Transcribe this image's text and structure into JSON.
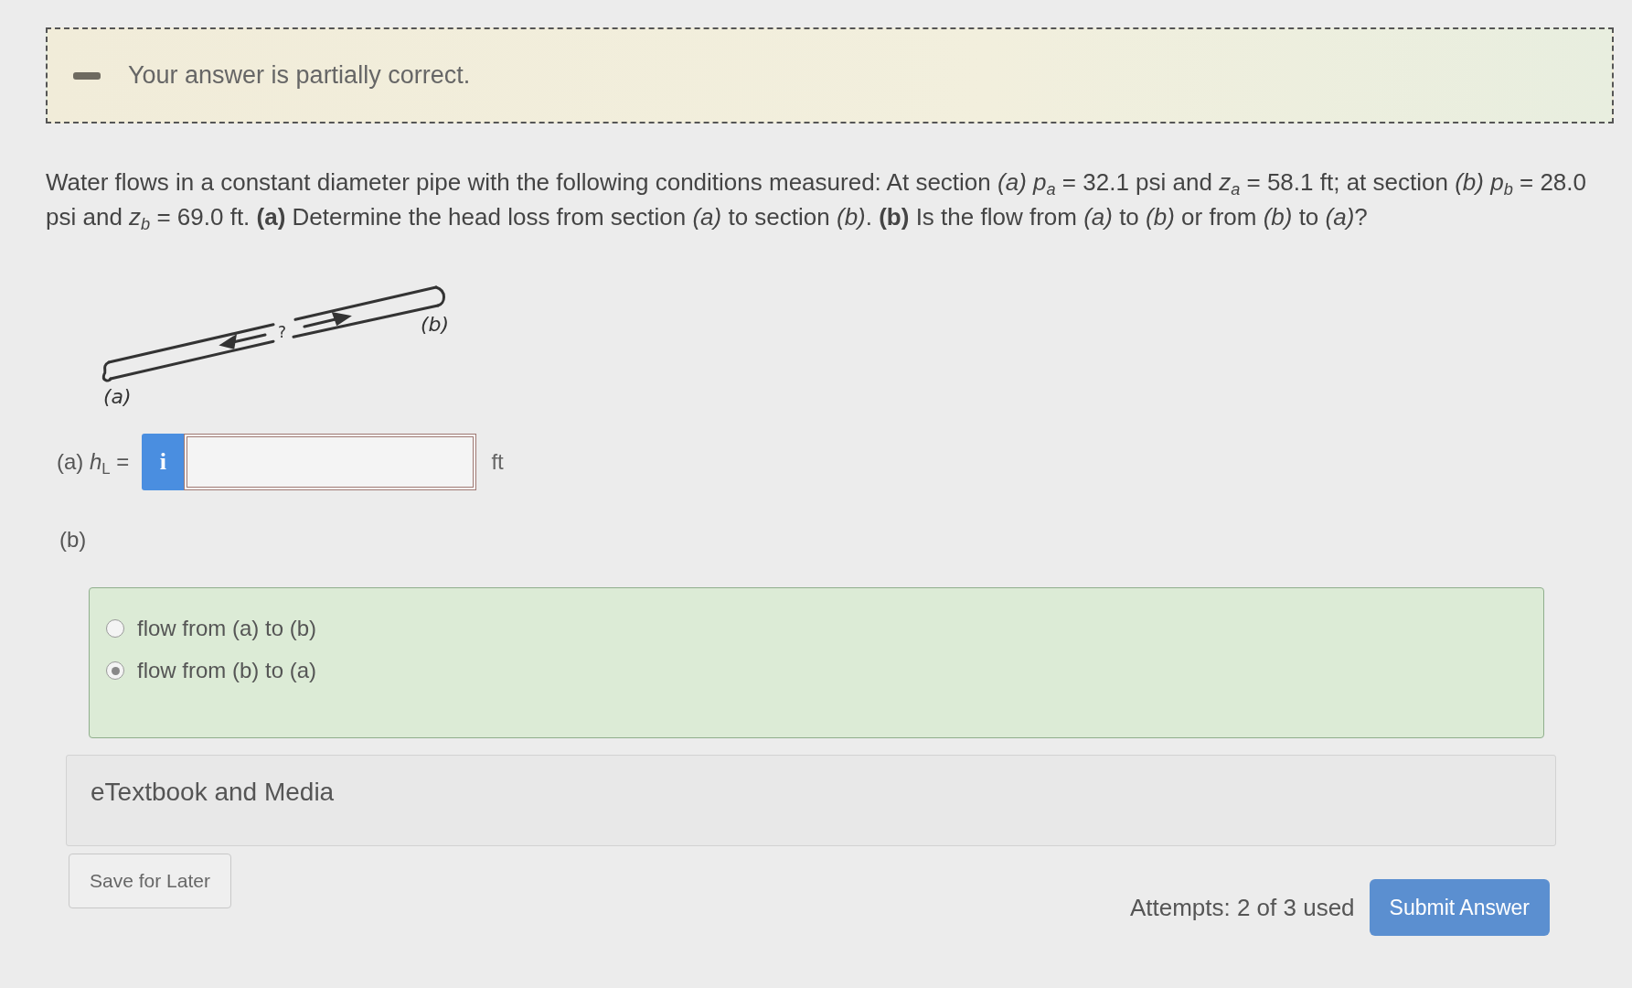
{
  "feedback": {
    "message": "Your answer is partially correct."
  },
  "question": {
    "text": "Water flows in a constant diameter pipe with the following conditions measured: At section *(a)* *p*$_{a}$ = 32.1 psi and *z*$_{a}$ = 58.1 ft; at section *(b)* *p*$_{b}$ = 28.0 psi and *z*$_{b}$ = 69.0 ft. **(a)** Determine the head loss from section *(a)* to section *(b)*. **(b)** Is the flow from *(a)* to *(b)* or from *(b)* to *(a)*?"
  },
  "figure": {
    "labels": [
      "(a)",
      "(b)",
      "?"
    ]
  },
  "part_a": {
    "label": "(a) *h*$_{L}$ =",
    "info_button": "i",
    "correct": false,
    "unit": "ft"
  },
  "part_b": {
    "label": "(b)",
    "correct": true,
    "options": [
      {
        "label": "flow from (a) to (b)",
        "selected": false
      },
      {
        "label": "flow from (b) to (a)",
        "selected": true
      }
    ]
  },
  "resources": {
    "label": "eTextbook and Media"
  },
  "footer": {
    "save_button": "Save for Later",
    "attempts": "Attempts: 2 of 3 used",
    "submit_button": "Submit Answer"
  }
}
